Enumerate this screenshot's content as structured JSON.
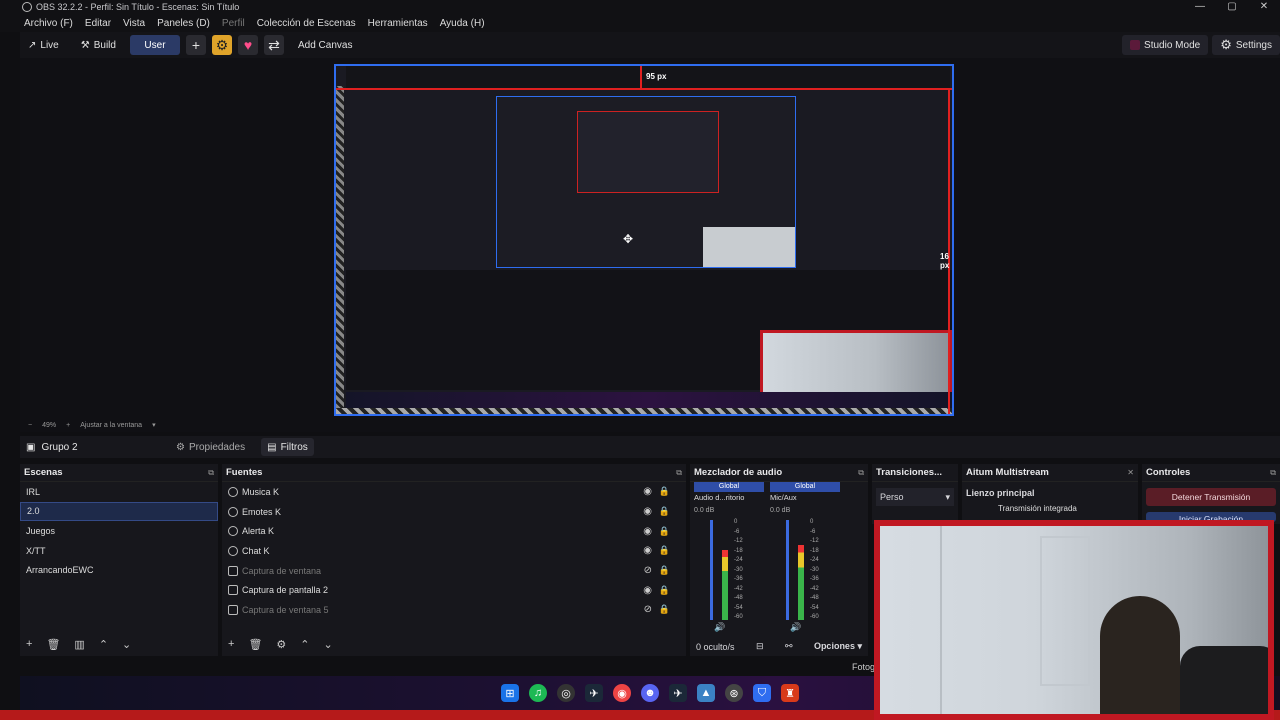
{
  "window": {
    "title": "OBS 32.2.2 - Perfil: Sin Título - Escenas: Sin Título",
    "minimize": "—",
    "maximize": "▢",
    "close": "✕"
  },
  "menu": {
    "items": [
      "Archivo (F)",
      "Editar",
      "Vista",
      "Paneles (D)",
      "Perfil",
      "Colección de Escenas",
      "Herramientas",
      "Ayuda (H)"
    ]
  },
  "toolbar": {
    "live_label": "Live",
    "build_label": "Build",
    "user_label": "User",
    "add_canvas_label": "Add Canvas",
    "studio_mode_label": "Studio Mode",
    "settings_label": "Settings"
  },
  "preview": {
    "top_px_label": "95 px",
    "right_px_label": "16 px"
  },
  "zoom": {
    "minus": "−",
    "level": "49%",
    "plus": "+",
    "fit_label": "Ajustar a la ventana"
  },
  "source_bar": {
    "group_label": "Grupo 2",
    "properties_label": "Propiedades",
    "filters_label": "Filtros"
  },
  "scenes": {
    "title": "Escenas",
    "items": [
      "IRL",
      "2.0",
      "Juegos",
      "X/TT",
      "ArrancandoEWC"
    ],
    "selected_index": 1
  },
  "sources": {
    "title": "Fuentes",
    "items": [
      {
        "name": "Musica K",
        "type": "audio",
        "visible": true
      },
      {
        "name": "Emotes K",
        "type": "audio",
        "visible": true
      },
      {
        "name": "Alerta K",
        "type": "audio",
        "visible": true
      },
      {
        "name": "Chat K",
        "type": "audio",
        "visible": true
      },
      {
        "name": "Captura de ventana",
        "type": "window",
        "visible": false
      },
      {
        "name": "Captura de pantalla 2",
        "type": "screen",
        "visible": true
      },
      {
        "name": "Captura de ventana 5",
        "type": "window",
        "visible": false
      }
    ]
  },
  "mixer": {
    "title": "Mezclador de audio",
    "channels": [
      {
        "tag": "Global",
        "name": "Audio d...ritorio",
        "db": "0.0 dB",
        "level": 0.3
      },
      {
        "tag": "Global",
        "name": "Mic/Aux",
        "db": "0.0 dB",
        "level": 0.25
      }
    ],
    "scale": [
      "0",
      "-6",
      "-12",
      "-18",
      "-24",
      "-30",
      "-36",
      "-42",
      "-48",
      "-54",
      "-60"
    ],
    "hidden_label": "0 oculto/s",
    "options_label": "Opciones"
  },
  "transitions": {
    "title": "Transiciones...",
    "selected": "Perso"
  },
  "multistream": {
    "title": "Aitum Multistream",
    "canvas_label": "Lienzo principal",
    "row_label": "Transmisión integrada"
  },
  "controls": {
    "title": "Controles",
    "stop_stream": "Detener Transmisión",
    "start_record": "Iniciar Grabación"
  },
  "status": {
    "fotog_label": "Fotog"
  },
  "colors": {
    "accent": "#2f6df0",
    "live_red": "#c01822",
    "selected_bg": "#1e2a4a"
  }
}
